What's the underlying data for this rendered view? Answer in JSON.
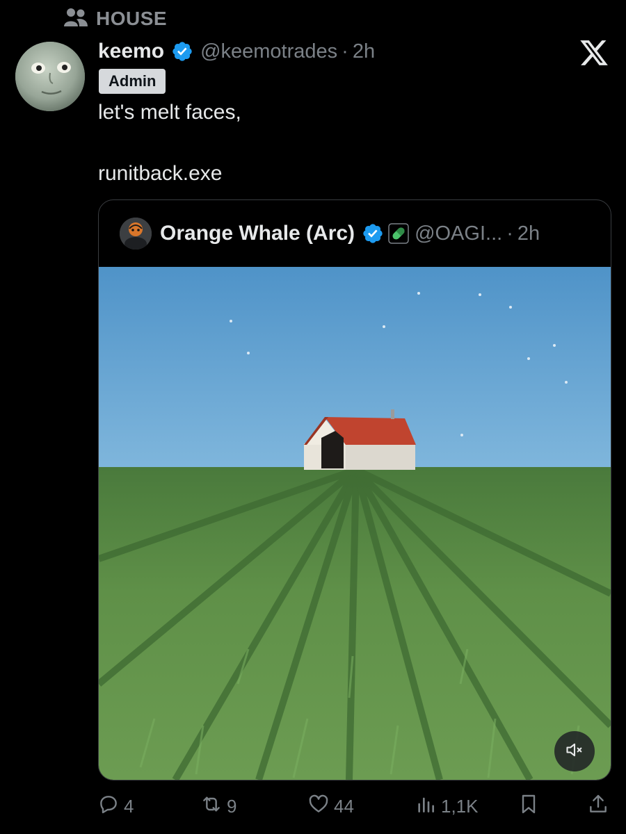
{
  "community": {
    "label": "HOUSE",
    "icon": "people-icon"
  },
  "post": {
    "display_name": "keemo",
    "handle": "@keemotrades",
    "separator": "·",
    "time": "2h",
    "badge": "Admin",
    "text": "let's melt faces,\n\nrunitback.exe"
  },
  "quoted": {
    "display_name": "Orange Whale (Arc)",
    "handle": "@OAGI...",
    "separator": "·",
    "time": "2h"
  },
  "actions": {
    "replies": "4",
    "reposts": "9",
    "likes": "44",
    "views": "1,1K"
  },
  "colors": {
    "verified": "#1d9bf0",
    "muted_text": "#7b8187",
    "background": "#000000"
  }
}
